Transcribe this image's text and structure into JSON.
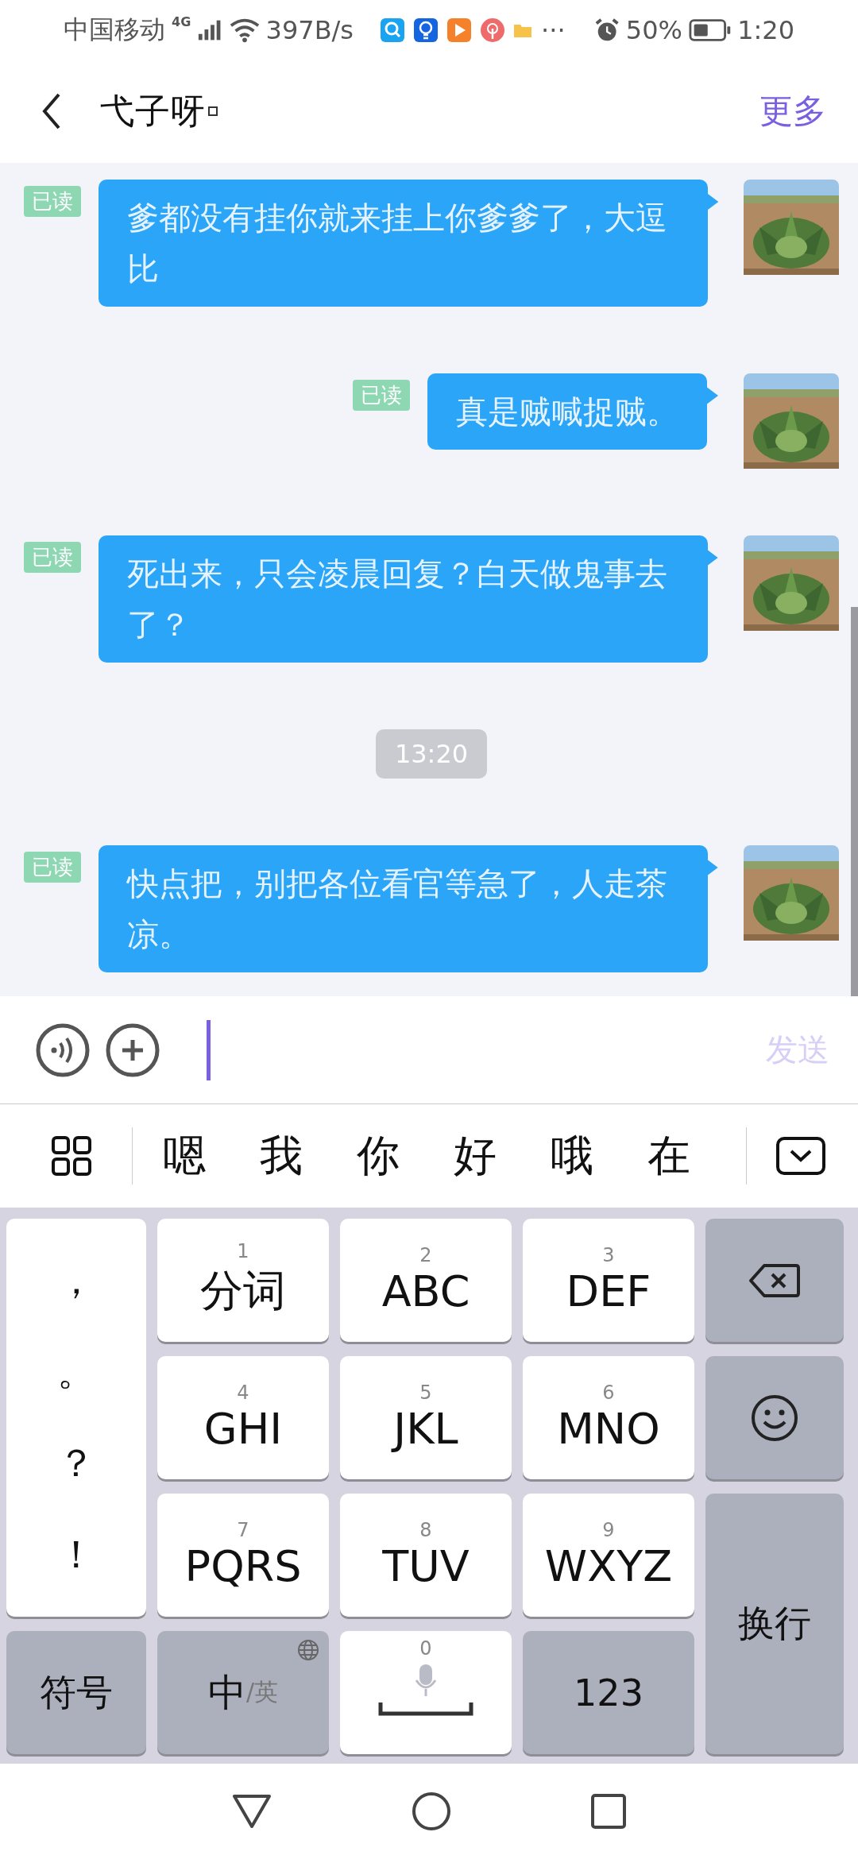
{
  "status_bar": {
    "carrier": "中国移动",
    "network": "4G",
    "speed": "397B/s",
    "more": "···",
    "battery": "50%",
    "time": "1:20"
  },
  "header": {
    "title": "弋子呀",
    "action": "更多"
  },
  "messages": [
    {
      "kind": "message",
      "read_label": "已读",
      "text": "爹都没有挂你就来挂上你爹爹了，大逗比"
    },
    {
      "kind": "message",
      "read_label": "已读",
      "text": "真是贼喊捉贼。"
    },
    {
      "kind": "message",
      "read_label": "已读",
      "text": "死出来，只会凌晨回复？白天做鬼事去了？"
    },
    {
      "kind": "time",
      "text": "13:20"
    },
    {
      "kind": "message",
      "read_label": "已读",
      "text": "快点把，别把各位看官等急了，人走茶凉。"
    }
  ],
  "composer": {
    "send": "发送",
    "disabled": true
  },
  "candidates": [
    "嗯",
    "我",
    "你",
    "好",
    "哦",
    "在"
  ],
  "keyboard": {
    "punctuation": [
      "，",
      "。",
      "？",
      "！"
    ],
    "keys": [
      {
        "number": "1",
        "label": "分词"
      },
      {
        "number": "2",
        "label": "ABC"
      },
      {
        "number": "3",
        "label": "DEF"
      },
      {
        "number": "4",
        "label": "GHI"
      },
      {
        "number": "5",
        "label": "JKL"
      },
      {
        "number": "6",
        "label": "MNO"
      },
      {
        "number": "7",
        "label": "PQRS"
      },
      {
        "number": "8",
        "label": "TUV"
      },
      {
        "number": "9",
        "label": "WXYZ"
      }
    ],
    "symbols": "符号",
    "lang_primary": "中",
    "lang_secondary": "/英",
    "space_number": "0",
    "numbers": "123",
    "enter": "换行"
  }
}
